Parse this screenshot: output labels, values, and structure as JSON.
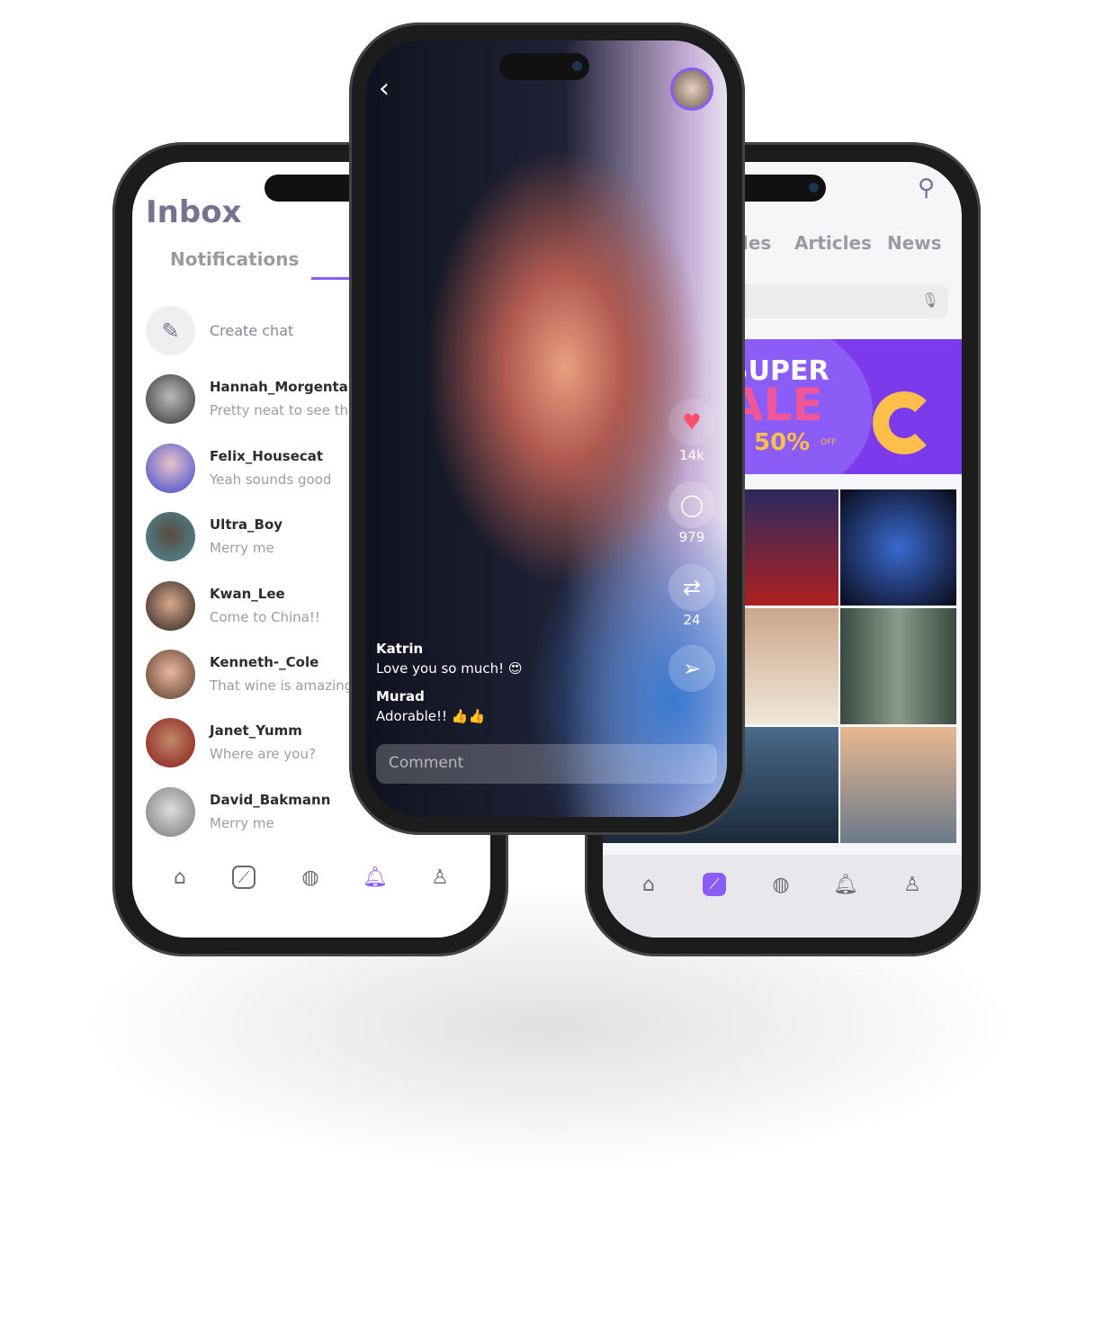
{
  "inbox": {
    "title": "Inbox",
    "tab_notifications": "Notifications",
    "create_chat": "Create chat",
    "chats": [
      {
        "name": "Hannah_Morgental",
        "message": "Pretty neat to see the"
      },
      {
        "name": "Felix_Housecat",
        "message": "Yeah sounds good"
      },
      {
        "name": "Ultra_Boy",
        "message": "Merry me"
      },
      {
        "name": "Kwan_Lee",
        "message": "Come to China!!"
      },
      {
        "name": "Kenneth-_Cole",
        "message": "That wine is amazing!"
      },
      {
        "name": "Janet_Yumm",
        "message": "Where are you?"
      },
      {
        "name": "David_Bakmann",
        "message": "Merry me"
      }
    ],
    "nav_active": "notifications"
  },
  "story": {
    "likes": "14k",
    "comments_count": "979",
    "reposts": "24",
    "comments": [
      {
        "author": "Katrin",
        "text": "Love you so much! 😍"
      },
      {
        "author": "Murad",
        "text": "Adorable!! 👍👍"
      }
    ],
    "comment_placeholder": "Comment"
  },
  "explore": {
    "tabs": [
      "les",
      "Articles",
      "News"
    ],
    "banner": {
      "line1": "SUPER",
      "line2": "ALE",
      "line3": "50%",
      "off": "OFF"
    },
    "nav_active": "explore"
  },
  "colors": {
    "accent": "#8b5cf6",
    "banner": "#7c3aed"
  }
}
